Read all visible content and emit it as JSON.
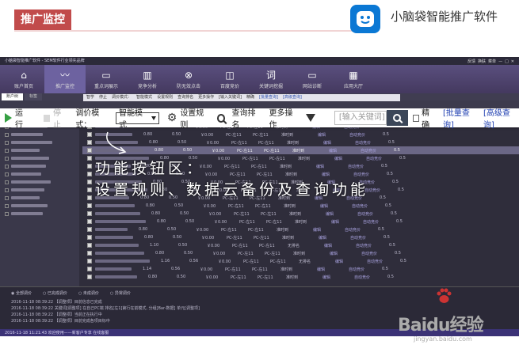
{
  "slide": {
    "tag": "推广监控",
    "brand": "小脑袋智能推广软件",
    "brand_color": "#0b78d4",
    "tag_color": "#c14b4b"
  },
  "app": {
    "window_title": "小脑袋智能推广软件 - SEM软件行业领先品牌",
    "window_buttons": [
      "反馈",
      "换肤",
      "菜单",
      "—",
      "□",
      "✕"
    ],
    "nav": [
      {
        "label": "账户首页",
        "icon": "home-icon",
        "glyph": "⌂"
      },
      {
        "label": "推广监控",
        "icon": "pulse-icon",
        "glyph": "〰",
        "active": true
      },
      {
        "label": "重点词展示",
        "icon": "display-icon",
        "glyph": "▭"
      },
      {
        "label": "竞争分析",
        "icon": "bars-icon",
        "glyph": "▥"
      },
      {
        "label": "防无效点击",
        "icon": "block-icon",
        "glyph": "⊗"
      },
      {
        "label": "百度竞价",
        "icon": "bag-icon",
        "glyph": "◫"
      },
      {
        "label": "关键词挖掘",
        "icon": "word-icon",
        "glyph": "词"
      },
      {
        "label": "网站诊断",
        "icon": "monitor-icon",
        "glyph": "▭"
      },
      {
        "label": "应用大厅",
        "icon": "grid-icon",
        "glyph": "▦"
      }
    ],
    "subtabs": [
      "账户树",
      "标签"
    ],
    "mini_toolbar": [
      "智学",
      "停止",
      "调价模式：",
      "智能模式",
      "设置规则",
      "查询排名",
      "更多操作",
      "[输入关键词]",
      "精确",
      "[批量查询]",
      "[高级查询]"
    ],
    "toolbar": {
      "run": "运行",
      "stop": "停止",
      "bid_mode_label": "调价模式：",
      "bid_mode_value": "智能模式",
      "set_rules": "设置规则",
      "query_rank": "查询排名",
      "more_ops": "更多操作",
      "keyword_placeholder": "[输入关键词]",
      "exact": "精确",
      "batch_query": "[批量查询]",
      "advanced_query": "[高级查询]"
    },
    "rows": [
      {
        "c1": "0.80",
        "c2": "0.50",
        "c3": "￥0.00",
        "c4": "PC-左11",
        "c5": "PC-左11",
        "c6": "准时到",
        "c7": "编辑",
        "c8": "自动竞价",
        "c9": "0.5"
      },
      {
        "c1": "0.80",
        "c2": "0.50",
        "c3": "￥0.00",
        "c4": "PC-左11",
        "c5": "PC-左11",
        "c6": "准时到",
        "c7": "编辑",
        "c8": "自动竞价",
        "c9": "0.5"
      },
      {
        "c1": "0.80",
        "c2": "0.50",
        "c3": "￥0.00",
        "c4": "PC-左11",
        "c5": "PC-左11",
        "c6": "准时到",
        "c7": "编辑",
        "c8": "自动竞价",
        "c9": "0.5"
      },
      {
        "c1": "0.80",
        "c2": "0.50",
        "c3": "￥0.00",
        "c4": "PC-左11",
        "c5": "PC-左11",
        "c6": "准时到",
        "c7": "编辑",
        "c8": "自动竞价",
        "c9": "0.5",
        "hl": true
      },
      {
        "c1": "0.80",
        "c2": "0.50",
        "c3": "￥0.00",
        "c4": "PC-左11",
        "c5": "PC-左11",
        "c6": "准时到",
        "c7": "编辑",
        "c8": "自动竞价",
        "c9": "0.5"
      },
      {
        "c1": "0.80",
        "c2": "0.50",
        "c3": "￥0.00",
        "c4": "PC-左11",
        "c5": "PC-左11",
        "c6": "准时到",
        "c7": "编辑",
        "c8": "自动竞价",
        "c9": "0.5"
      },
      {
        "c1": "0.80",
        "c2": "0.50",
        "c3": "￥0.00",
        "c4": "PC-左11",
        "c5": "PC-左11",
        "c6": "准时到",
        "c7": "编辑",
        "c8": "自动竞价",
        "c9": "0.5"
      },
      {
        "c1": "0.80",
        "c2": "0.50",
        "c3": "￥0.00",
        "c4": "PC-左11",
        "c5": "PC-左11",
        "c6": "准时到",
        "c7": "编辑",
        "c8": "自动竞价",
        "c9": "0.5"
      },
      {
        "c1": "0.80",
        "c2": "0.50",
        "c3": "￥0.00",
        "c4": "PC-左11",
        "c5": "PC-左11",
        "c6": "准时到",
        "c7": "编辑",
        "c8": "自动竞价",
        "c9": "0.5"
      },
      {
        "c1": "0.80",
        "c2": "0.50",
        "c3": "￥0.00",
        "c4": "PC-左11",
        "c5": "PC-左11",
        "c6": "准时到",
        "c7": "编辑",
        "c8": "自动竞价",
        "c9": "0.5"
      },
      {
        "c1": "0.80",
        "c2": "0.50",
        "c3": "￥0.00",
        "c4": "PC-左11",
        "c5": "PC-左11",
        "c6": "准时到",
        "c7": "编辑",
        "c8": "自动竞价",
        "c9": "0.5"
      },
      {
        "c1": "0.80",
        "c2": "0.50",
        "c3": "￥0.00",
        "c4": "PC-左11",
        "c5": "PC-左11",
        "c6": "准时到",
        "c7": "编辑",
        "c8": "自动竞价",
        "c9": "0.5"
      },
      {
        "c1": "0.80",
        "c2": "0.50",
        "c3": "￥0.00",
        "c4": "PC-左11",
        "c5": "PC-左11",
        "c6": "准时到",
        "c7": "编辑",
        "c8": "自动竞价",
        "c9": "0.5"
      },
      {
        "c1": "0.80",
        "c2": "0.50",
        "c3": "￥0.00",
        "c4": "PC-左11",
        "c5": "PC-左11",
        "c6": "准时到",
        "c7": "编辑",
        "c8": "自动竞价",
        "c9": "0.5"
      },
      {
        "c1": "0.80",
        "c2": "0.50",
        "c3": "￥0.00",
        "c4": "PC-左11",
        "c5": "PC-左11",
        "c6": "准时到",
        "c7": "编辑",
        "c8": "自动竞价",
        "c9": "0.5"
      },
      {
        "c1": "1.10",
        "c2": "0.50",
        "c3": "￥0.00",
        "c4": "PC-左11",
        "c5": "PC-左11",
        "c6": "无排名",
        "c7": "编辑",
        "c8": "自动竞价",
        "c9": "0.5"
      },
      {
        "c1": "0.80",
        "c2": "0.50",
        "c3": "￥0.00",
        "c4": "PC-左11",
        "c5": "PC-左11",
        "c6": "准时到",
        "c7": "编辑",
        "c8": "自动竞价",
        "c9": "0.5"
      },
      {
        "c1": "1.16",
        "c2": "0.56",
        "c3": "￥0.00",
        "c4": "PC-左11",
        "c5": "PC-左11",
        "c6": "无排名",
        "c7": "编辑",
        "c8": "自动竞价",
        "c9": "0.5"
      },
      {
        "c1": "1.14",
        "c2": "0.56",
        "c3": "￥0.00",
        "c4": "PC-左11",
        "c5": "PC-左11",
        "c6": "准时到",
        "c7": "编辑",
        "c8": "自动竞价",
        "c9": "0.5"
      },
      {
        "c1": "0.80",
        "c2": "0.50",
        "c3": "￥0.00",
        "c4": "PC-左11",
        "c5": "PC-左11",
        "c6": "准时到",
        "c7": "编辑",
        "c8": "自动竞价",
        "c9": "0.5"
      }
    ],
    "bottom": {
      "radios": [
        "全部调价",
        "已完成调价",
        "未成调价",
        "异常调价"
      ],
      "log": [
        "2016-11-18 08:39:22 【调整项】目前信息已完成",
        "2016-11-18 08:39:22 关键词[调整项] 在自己PC端 排名[左1]第行在前模式, 分组[Bar-数据] 单元[调整项]",
        "2016-11-18 08:39:22 【调整项】当前正在执行中",
        "2016-11-18 08:39:22 【调整项】目前完成各项目标中"
      ]
    },
    "status": "2016-11-18 11:21:43  欢迎使用——新客户专享  在线客服"
  },
  "annotation": {
    "line1": "功能按钮区：",
    "line2": "设置规则、数据云备份及查询功能"
  },
  "watermark": {
    "brand": "Baidu经验",
    "url": "jingyan.baidu.com"
  }
}
